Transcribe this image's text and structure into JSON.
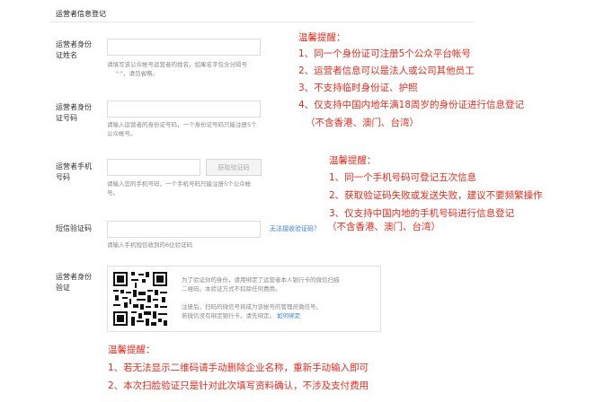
{
  "section": {
    "title": "运营者信息登记"
  },
  "fields": [
    {
      "label_line1": "运营者身份",
      "label_line2": "证姓名",
      "hint_line1": "请填写该公众帐号运营者的姓名，如果名字包含分隔号",
      "hint_line2": "\"·\"，请勿省略。"
    },
    {
      "label_line1": "运营者身份",
      "label_line2": "证号码",
      "hint_line1": "请输入运营者的身份证号码，一个身份证号码只能注册5个",
      "hint_line2": "公众帐号。"
    },
    {
      "label_line1": "运营者手机",
      "label_line2": "号码",
      "button": "获取验证码",
      "hint_line1": "请输入您的手机号码，一个手机号码只能注册5个公众帐",
      "hint_line2": "号。"
    },
    {
      "label_line1": "短信验证码",
      "link": "无法接收验证码？",
      "hint_line1": "请输入手机短信收到的6位验证码"
    }
  ],
  "verify": {
    "label_line1": "运营者身份",
    "label_line2": "验证",
    "desc_line1": "为了验证你的身份，请用绑定了运营者本人银行卡的微信扫描",
    "desc_line2": "二维码。本验证方式不扣除任何费用。",
    "note_line1": "注册后，扫码的微信号将成为该帐号的管理员微信号。",
    "note_line2": "若微信没有绑定银行卡，请先绑定。",
    "note_link": "如何绑定"
  },
  "tips1": {
    "title": "温馨提醒：",
    "items": [
      "1、同一个身份证可注册5个公众平台帐号",
      "2、运营者信息可以是法人或公司其他员工",
      "3、不支持临时身份证、护照",
      "4、仅支持中国内地年满18周岁的身份证进行信息登记"
    ],
    "footnote": "（不含香港、澳门、台湾）"
  },
  "tips2": {
    "title": "温馨提醒：",
    "items": [
      "1、同一个手机号码可登记五次信息",
      "2、获取验证码失败或发送失败，建议不要频繁操作",
      "3、仅支持中国内地的手机号码进行信息登记"
    ],
    "footnote": "（不含香港、澳门、台湾）"
  },
  "tips3": {
    "title": "温馨提醒：",
    "items": [
      "1、若无法显示二维码请手动删除企业名称，重新手动输入即可",
      "2、本次扫脸验证只是针对此次填写资料确认，不涉及支付费用"
    ]
  },
  "colors": {
    "accent": "#e22c1f",
    "link": "#3b7ed6"
  }
}
